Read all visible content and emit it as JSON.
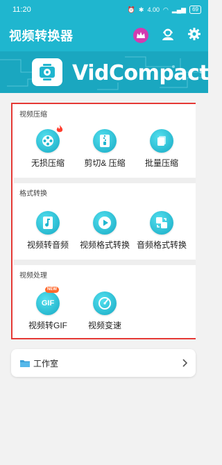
{
  "status": {
    "time": "11:20",
    "speed": "4.00\nKB/s",
    "battery": "69"
  },
  "app": {
    "title": "视频转换器"
  },
  "banner": {
    "brand": "VidCompact"
  },
  "sections": [
    {
      "title": "视频压缩",
      "items": [
        {
          "label": "无损压缩",
          "icon": "film-reel-icon",
          "flag": "hot-fire-icon"
        },
        {
          "label": "剪切& 压缩",
          "icon": "zipper-file-icon"
        },
        {
          "label": "批量压缩",
          "icon": "stack-files-icon"
        }
      ]
    },
    {
      "title": "格式转换",
      "items": [
        {
          "label": "视频转音频",
          "icon": "music-note-icon"
        },
        {
          "label": "视频格式转换",
          "icon": "play-icon"
        },
        {
          "label": "音频格式转换",
          "icon": "convert-icon"
        }
      ]
    },
    {
      "title": "视频处理",
      "items": [
        {
          "label": "视频转GIF",
          "icon": "gif-icon",
          "badge": "NEW",
          "icon_text": "GIF"
        },
        {
          "label": "视频变速",
          "icon": "speedometer-icon"
        }
      ]
    }
  ],
  "studio": {
    "label": "工作室"
  },
  "colors": {
    "accent": "#1fb6cf",
    "frame": "#e53935",
    "crown": "#d23bb0"
  }
}
